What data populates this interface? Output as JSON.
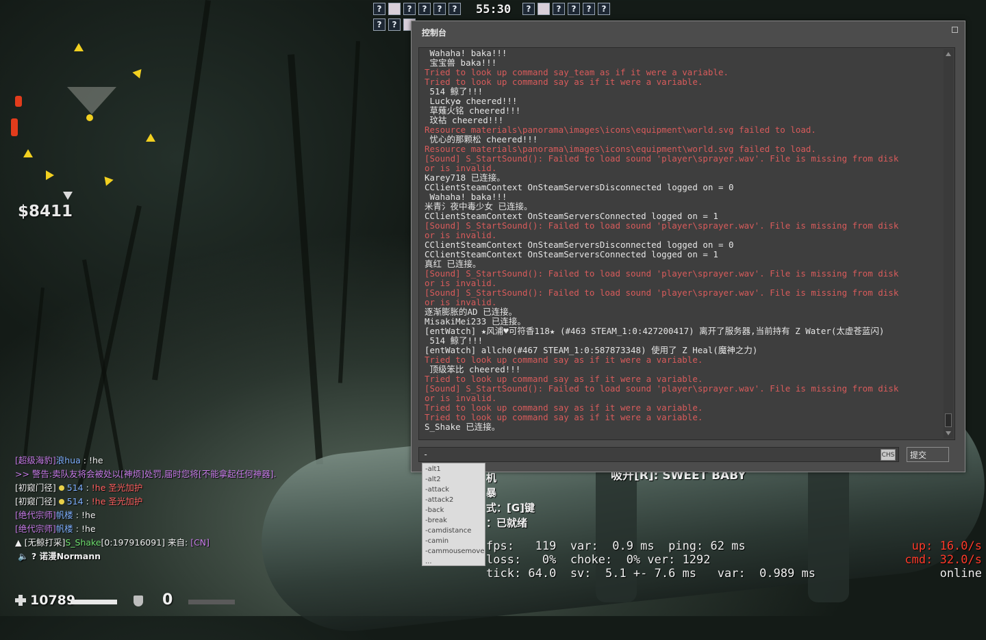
{
  "hud": {
    "money": "$8411",
    "health": "10789",
    "armor": "0",
    "timer": "55:30",
    "top_row_1": [
      "?",
      "",
      "?",
      "?",
      "?",
      "?"
    ],
    "top_row_1_right": [
      "?",
      "",
      "?",
      "?",
      "?",
      "?"
    ],
    "top_row_2": [
      "?",
      "?",
      ""
    ]
  },
  "console": {
    "title": "控制台",
    "lines": [
      {
        "t": " Wahaha! baka!!!",
        "e": false
      },
      {
        "t": " 宝宝兽 baka!!!",
        "e": false
      },
      {
        "t": "Tried to look up command say_team as if it were a variable.",
        "e": true
      },
      {
        "t": "Tried to look up command say as if it were a variable.",
        "e": true
      },
      {
        "t": " 514 鲸了!!!",
        "e": false
      },
      {
        "t": " Lucky✿ cheered!!!",
        "e": false
      },
      {
        "t": " 草薙火铭 cheered!!!",
        "e": false
      },
      {
        "t": " 玟祜 cheered!!!",
        "e": false
      },
      {
        "t": "Resource materials\\panorama\\images\\icons\\equipment\\world.svg failed to load.",
        "e": true
      },
      {
        "t": " 忧心的那颗松 cheered!!!",
        "e": false
      },
      {
        "t": "Resource materials\\panorama\\images\\icons\\equipment\\world.svg failed to load.",
        "e": true
      },
      {
        "t": "[Sound] S_StartSound(): Failed to load sound 'player\\sprayer.wav'. File is missing from disk",
        "e": true
      },
      {
        "t": "or is invalid.",
        "e": true
      },
      {
        "t": "Karey718 已连接。",
        "e": false
      },
      {
        "t": "CClientSteamContext OnSteamServersDisconnected logged on = 0",
        "e": false
      },
      {
        "t": " Wahaha! baka!!!",
        "e": false
      },
      {
        "t": "米青氵夜中毒少女 已连接。",
        "e": false
      },
      {
        "t": "CClientSteamContext OnSteamServersConnected logged on = 1",
        "e": false
      },
      {
        "t": "[Sound] S_StartSound(): Failed to load sound 'player\\sprayer.wav'. File is missing from disk",
        "e": true
      },
      {
        "t": "or is invalid.",
        "e": true
      },
      {
        "t": "CClientSteamContext OnSteamServersDisconnected logged on = 0",
        "e": false
      },
      {
        "t": "CClientSteamContext OnSteamServersConnected logged on = 1",
        "e": false
      },
      {
        "t": "真红 已连接。",
        "e": false
      },
      {
        "t": "[Sound] S_StartSound(): Failed to load sound 'player\\sprayer.wav'. File is missing from disk",
        "e": true
      },
      {
        "t": "or is invalid.",
        "e": true
      },
      {
        "t": "[Sound] S_StartSound(): Failed to load sound 'player\\sprayer.wav'. File is missing from disk",
        "e": true
      },
      {
        "t": "or is invalid.",
        "e": true
      },
      {
        "t": "逐渐膨胀的AD 已连接。",
        "e": false
      },
      {
        "t": "MisakiMei233 已连接。",
        "e": false
      },
      {
        "t": "[entWatch] ★风浦♥可符香118★ (#463 STEAM_1:0:427200417) 离开了服务器,当前持有 Z Water(太虚苍蓝闪)",
        "e": false
      },
      {
        "t": " 514 鲸了!!!",
        "e": false
      },
      {
        "t": "[entWatch] allch0(#467 STEAM_1:0:587873348) 使用了 Z Heal(魔神之力)",
        "e": false
      },
      {
        "t": "Tried to look up command say as if it were a variable.",
        "e": true
      },
      {
        "t": " 顶级笨比 cheered!!!",
        "e": false
      },
      {
        "t": "Tried to look up command say as if it were a variable.",
        "e": true
      },
      {
        "t": "[Sound] S_StartSound(): Failed to load sound 'player\\sprayer.wav'. File is missing from disk",
        "e": true
      },
      {
        "t": "or is invalid.",
        "e": true
      },
      {
        "t": "Tried to look up command say as if it were a variable.",
        "e": true
      },
      {
        "t": "Tried to look up command say as if it were a variable.",
        "e": true
      },
      {
        "t": "S_Shake 已连接。",
        "e": false
      }
    ],
    "input_value": "-",
    "ime_label": "CHS",
    "submit_label": "提交"
  },
  "autocomplete": [
    "-alt1",
    "-alt2",
    "-attack",
    "-attack2",
    "-back",
    "-break",
    "-camdistance",
    "-camin",
    "-cammousemove",
    "..."
  ],
  "under_console": {
    "line1": "机",
    "line2": "暴",
    "line3": "式：[G]键",
    "line4": "：已就绪",
    "center": "吸开[R]: SWEET BABY"
  },
  "netgraph": {
    "left": "fps:   119  var:  0.9 ms  ping: 62 ms\nloss:   0%  choke:  0% ver: 1292\ntick: 64.0  sv:  5.1 +- 7.6 ms   var:  0.989 ms",
    "up": "up: 16.0/s",
    "cmd": "cmd: 32.0/s",
    "status": "online"
  },
  "chat": [
    {
      "tag": "[超级海豹]",
      "name": "浪hua",
      "sep": " : ",
      "msg": "!he"
    },
    {
      "warn": ">> 警告:卖队友将会被处以[神烦]处罚,届时您将[不能拿起任何神器]."
    },
    {
      "tag": "[初窥门径]",
      "name": "514",
      "sep": " : ",
      "msg": "!he 圣光加护"
    },
    {
      "tag": "[初窥门径]",
      "name": "514",
      "sep": " : ",
      "msg": "!he 圣光加护"
    },
    {
      "tag": "[绝代宗师]",
      "name": "帆楼",
      "sep": " : ",
      "msg": "!he"
    },
    {
      "tag": "[绝代宗师]",
      "name": "帆楼",
      "sep": " : ",
      "msg": "!he"
    },
    {
      "join_prefix": "▲ [无鲸打采]",
      "join_name": "S_Shake",
      "join_id": "[0:197916091]",
      "join_from": " 来自: ",
      "join_region": "[CN]"
    }
  ],
  "voice": {
    "icon": "speaker-icon",
    "q": "?",
    "name": "诺漫Normann"
  },
  "colors": {
    "error": "#d85b5b",
    "console_bg": "#3e3e3e",
    "net_red": "#ff3a2a"
  }
}
